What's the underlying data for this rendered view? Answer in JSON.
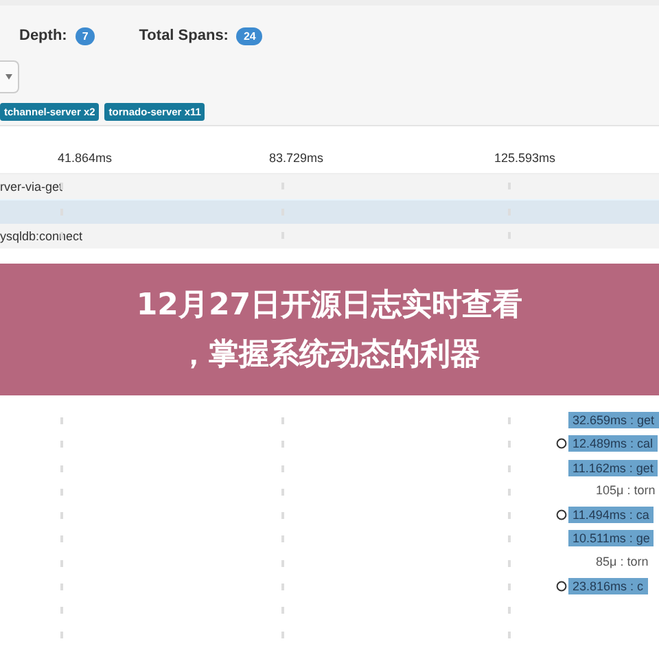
{
  "header": {
    "depth_label": "Depth:",
    "depth": "7",
    "spans_label": "Total Spans:",
    "spans": "24"
  },
  "services": [
    {
      "label": "tchannel-server x2"
    },
    {
      "label": "tornado-server x11"
    }
  ],
  "ticks": [
    "41.864ms",
    "83.729ms",
    "125.593ms"
  ],
  "upper_rows": [
    {
      "name": "rver-via-get",
      "selected": false
    },
    {
      "selected": true
    },
    {
      "name": "ysqldb:connect",
      "selected": false
    }
  ],
  "banner": {
    "lines": [
      "12月27日开源日志实时查看",
      "，掌握系统动态的利器"
    ]
  },
  "lower_rows": [
    {
      "kind": "bar",
      "label": "32.659ms : get",
      "error": false
    },
    {
      "kind": "bar",
      "label": "12.489ms : cal",
      "error": true
    },
    {
      "kind": "bar",
      "label": "11.162ms : get",
      "error": false
    },
    {
      "kind": "text",
      "label": "105μ : torn",
      "error": false
    },
    {
      "kind": "bar",
      "label": "11.494ms : ca",
      "error": true
    },
    {
      "kind": "bar",
      "label": "10.511ms : ge",
      "error": false
    },
    {
      "kind": "text",
      "label": "85μ : torn",
      "error": false
    },
    {
      "kind": "bar",
      "label": "23.816ms : c",
      "error": true
    },
    {
      "kind": "empty",
      "error": false
    },
    {
      "kind": "empty",
      "error": false
    }
  ]
}
